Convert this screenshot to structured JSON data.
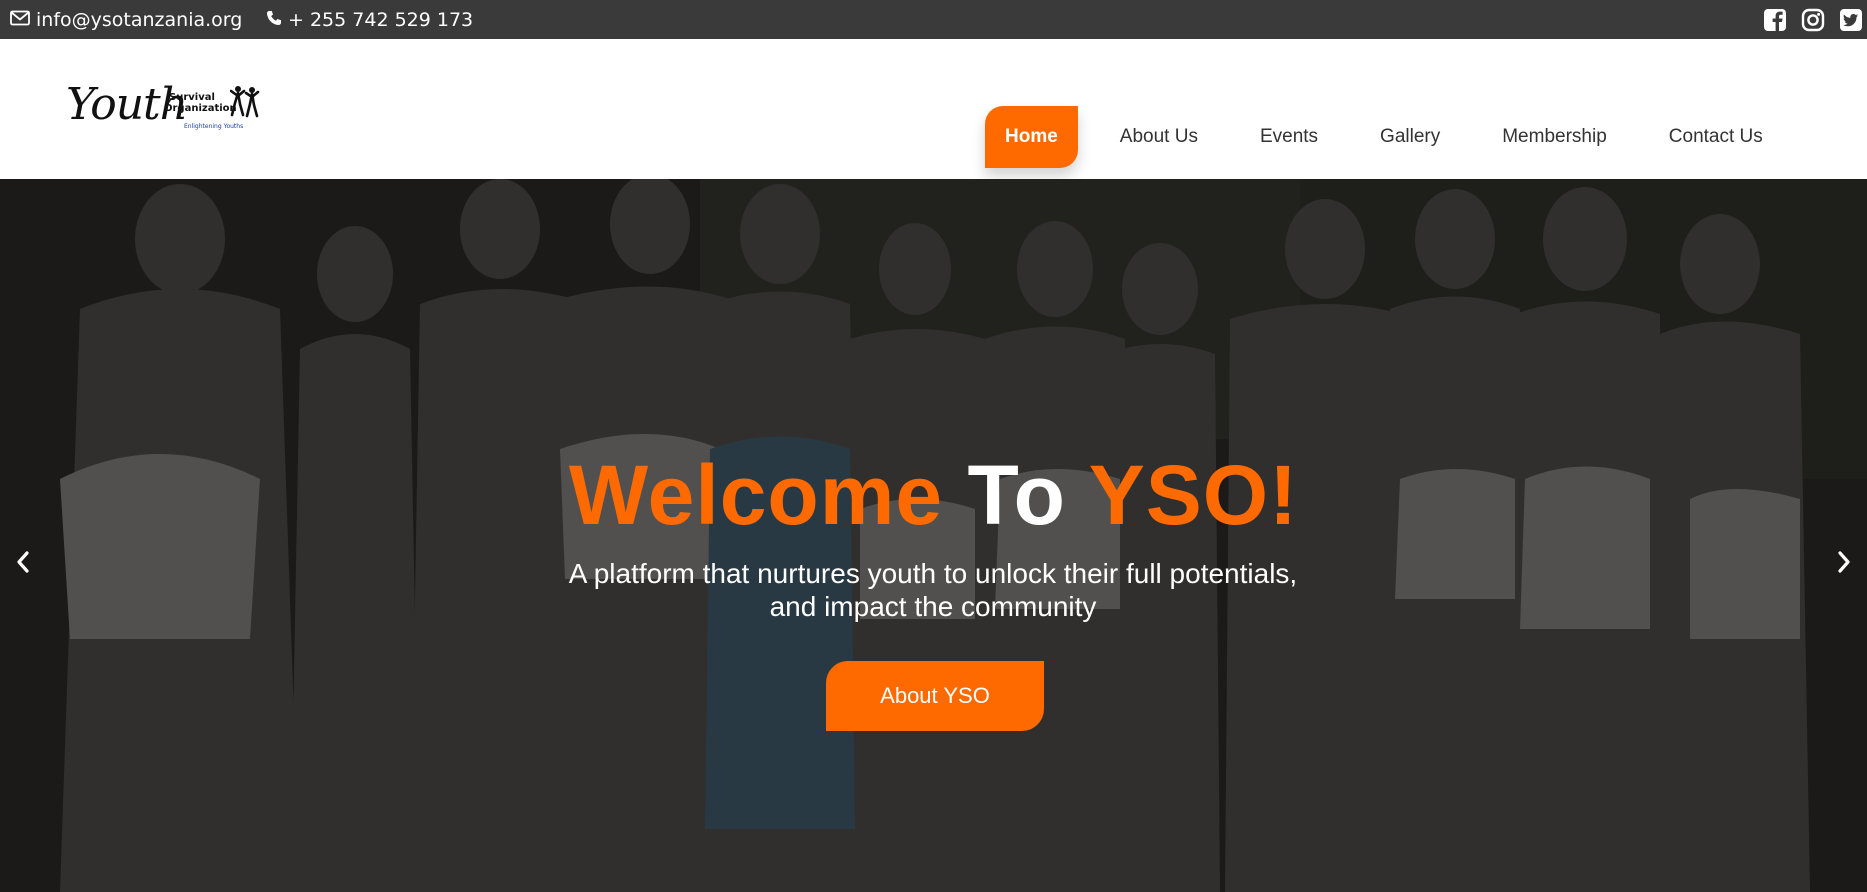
{
  "topbar": {
    "email": "info@ysotanzania.org",
    "phone": "+ 255 742 529 173",
    "icons": {
      "email": "envelope-icon",
      "phone": "phone-icon",
      "facebook": "facebook-icon",
      "instagram": "instagram-icon",
      "twitter": "twitter-icon"
    }
  },
  "logo": {
    "word": "Youth",
    "sub1": "Survival",
    "sub2": "Organization",
    "tagline": "Enlightening Youths"
  },
  "nav": {
    "items": [
      {
        "label": "Home",
        "active": true
      },
      {
        "label": "About Us",
        "active": false
      },
      {
        "label": "Events",
        "active": false
      },
      {
        "label": "Gallery",
        "active": false
      },
      {
        "label": "Membership",
        "active": false
      },
      {
        "label": "Contact Us",
        "active": false
      }
    ]
  },
  "hero": {
    "title_part1": "Welcome",
    "title_part2": "To",
    "title_part3": "YSO!",
    "subtitle_line1": "A platform that nurtures youth to unlock their full potentials,",
    "subtitle_line2": "and impact the community",
    "button_label": "About YSO",
    "prev_icon": "chevron-left-icon",
    "next_icon": "chevron-right-icon"
  },
  "colors": {
    "accent": "#ff6a00",
    "topbar_bg": "#3a3a3a",
    "header_bg": "#ffffff",
    "hero_text": "#ffffff"
  }
}
